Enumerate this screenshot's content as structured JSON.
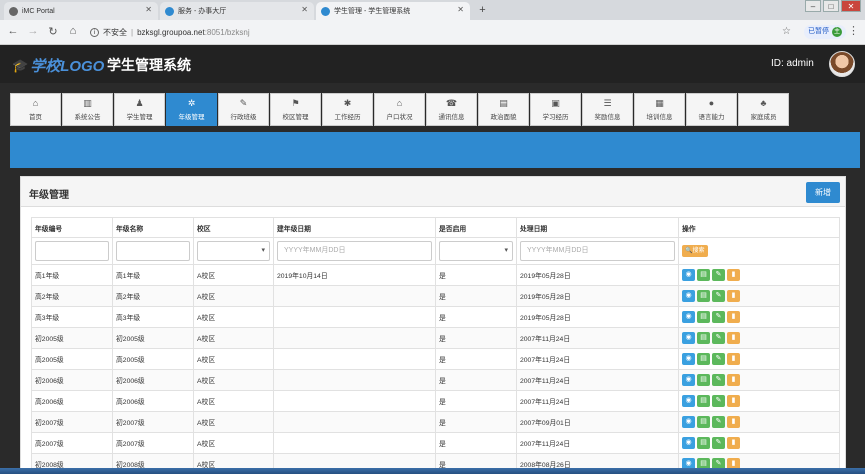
{
  "browser": {
    "tabs": [
      {
        "title": "iMC Portal",
        "icon": "globe-icon",
        "color": "#555555",
        "active": false
      },
      {
        "title": "服务 - 办事大厅",
        "icon": "app-icon",
        "color": "#2f8ad0",
        "active": false
      },
      {
        "title": "学生管理 - 学生管理系统",
        "icon": "app-icon",
        "color": "#2f8ad0",
        "active": true
      }
    ],
    "new_tab": "+",
    "address": {
      "security": "不安全",
      "host": "bzksgl.groupoa.net",
      "path": ":8051/bzksnj"
    },
    "paused_label": "已暂停",
    "profile_initial": "主"
  },
  "app": {
    "logo_text": "学校LOGO",
    "title": "学生管理系统",
    "user_label": "ID: admin"
  },
  "modules": [
    {
      "label": "首页",
      "icon": "home-icon",
      "glyph": "⌂"
    },
    {
      "label": "系统公告",
      "icon": "chart-icon",
      "glyph": "▥"
    },
    {
      "label": "学生管理",
      "icon": "user-icon",
      "glyph": "♟"
    },
    {
      "label": "年级管理",
      "icon": "gear-icon",
      "glyph": "✲",
      "active": true
    },
    {
      "label": "行政班级",
      "icon": "edit-icon",
      "glyph": "✎"
    },
    {
      "label": "校区管理",
      "icon": "sitemap-icon",
      "glyph": "⚑"
    },
    {
      "label": "工作经历",
      "icon": "asterisk-icon",
      "glyph": "✱"
    },
    {
      "label": "户口状况",
      "icon": "home-icon",
      "glyph": "⌂"
    },
    {
      "label": "通讯信息",
      "icon": "phone-icon",
      "glyph": "☎"
    },
    {
      "label": "政治面貌",
      "icon": "file-icon",
      "glyph": "▤"
    },
    {
      "label": "学习经历",
      "icon": "briefcase-icon",
      "glyph": "▣"
    },
    {
      "label": "奖励信息",
      "icon": "list-icon",
      "glyph": "☰"
    },
    {
      "label": "培训信息",
      "icon": "book-icon",
      "glyph": "▦"
    },
    {
      "label": "语言能力",
      "icon": "comment-icon",
      "glyph": "●"
    },
    {
      "label": "家庭成员",
      "icon": "users-icon",
      "glyph": "♣"
    }
  ],
  "panel": {
    "title": "年级管理",
    "add_button": "新增"
  },
  "table": {
    "headers": [
      "年级编号",
      "年级名称",
      "校区",
      "建年级日期",
      "是否启用",
      "处理日期",
      "操作"
    ],
    "filters": {
      "date_placeholder": "YYYY年MM月DD日",
      "search_button": "搜索"
    },
    "rows": [
      [
        "高1年级",
        "高1年级",
        "A校区",
        "2019年10月14日",
        "是",
        "2019年05月28日"
      ],
      [
        "高2年级",
        "高2年级",
        "A校区",
        "",
        "是",
        "2019年05月28日"
      ],
      [
        "高3年级",
        "高3年级",
        "A校区",
        "",
        "是",
        "2019年05月28日"
      ],
      [
        "初2005级",
        "初2005级",
        "A校区",
        "",
        "是",
        "2007年11月24日"
      ],
      [
        "高2005级",
        "高2005级",
        "A校区",
        "",
        "是",
        "2007年11月24日"
      ],
      [
        "初2006级",
        "初2006级",
        "A校区",
        "",
        "是",
        "2007年11月24日"
      ],
      [
        "高2006级",
        "高2006级",
        "A校区",
        "",
        "是",
        "2007年11月24日"
      ],
      [
        "初2007级",
        "初2007级",
        "A校区",
        "",
        "是",
        "2007年09月01日"
      ],
      [
        "高2007级",
        "高2007级",
        "A校区",
        "",
        "是",
        "2007年11月24日"
      ],
      [
        "初2008级",
        "初2008级",
        "A校区",
        "",
        "是",
        "2008年08月26日"
      ]
    ]
  },
  "colors": {
    "accent": "#2f8ad0",
    "success": "#5cb85c",
    "warning": "#f0ad4e",
    "info": "#3aa0e0"
  }
}
